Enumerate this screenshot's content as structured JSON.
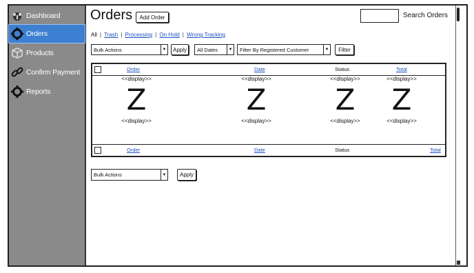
{
  "sidebar": {
    "items": [
      {
        "label": "Dashboard",
        "icon": "dashboard-icon",
        "active": false
      },
      {
        "label": "Orders",
        "icon": "gear-icon",
        "active": true
      },
      {
        "label": "Products",
        "icon": "box-icon",
        "active": false
      },
      {
        "label": "Confirm Payment",
        "icon": "link-icon",
        "active": false
      },
      {
        "label": "Reports",
        "icon": "gear-icon",
        "active": false
      }
    ]
  },
  "header": {
    "title": "Orders",
    "add_order_label": "Add Order",
    "search_label": "Search Orders",
    "search_value": ""
  },
  "filters": {
    "tabs": [
      "All",
      "Trash",
      "Processing",
      "On Hold",
      "Wrong Tracking"
    ]
  },
  "toolbar_top": {
    "bulk_actions": "Bulk Actions",
    "apply_label": "Apply",
    "dates": "All Dates",
    "customer_filter": "Filter By Registered Customer",
    "filter_label": "Filter"
  },
  "table": {
    "columns": [
      "Order",
      "Date",
      "Status",
      "Total"
    ],
    "placeholder_top": "<<display>>",
    "placeholder_bottom": "<<display>>",
    "cell_glyph": "Z"
  },
  "toolbar_bottom": {
    "bulk_actions": "Bulk Actions",
    "apply_label": "Apply"
  }
}
